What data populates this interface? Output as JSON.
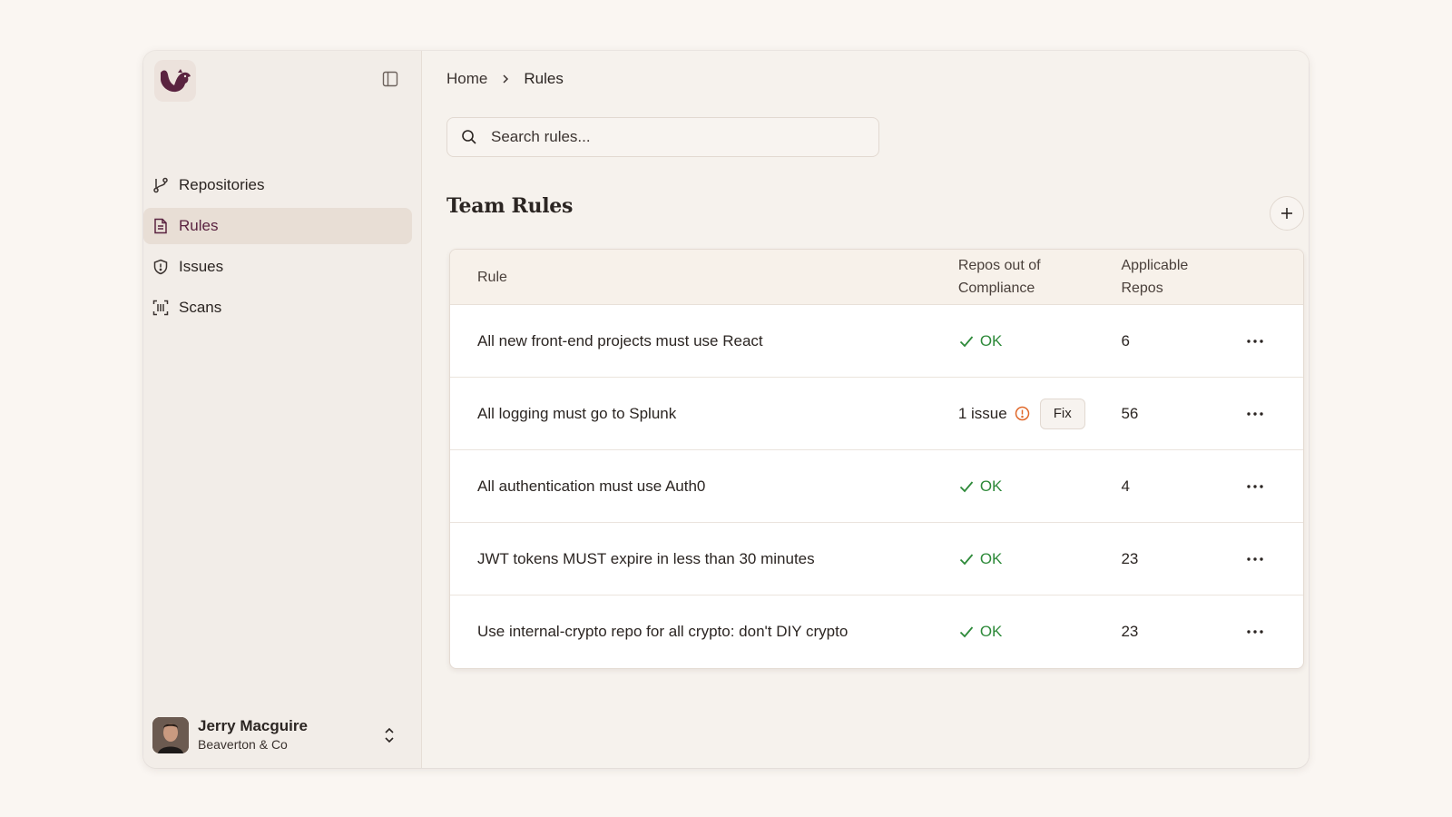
{
  "sidebar": {
    "logo_icon": "beaver-logo-icon",
    "toggle_icon": "sidebar-panel-icon",
    "items": [
      {
        "label": "Repositories",
        "icon": "git-branch-icon",
        "active": false
      },
      {
        "label": "Rules",
        "icon": "document-icon",
        "active": true
      },
      {
        "label": "Issues",
        "icon": "shield-alert-icon",
        "active": false
      },
      {
        "label": "Scans",
        "icon": "scan-barcode-icon",
        "active": false
      }
    ],
    "user": {
      "name": "Jerry Macguire",
      "org": "Beaverton & Co"
    }
  },
  "breadcrumb": {
    "home": "Home",
    "current": "Rules"
  },
  "search": {
    "placeholder": "Search rules..."
  },
  "section": {
    "title": "Team Rules"
  },
  "table": {
    "headers": {
      "rule": "Rule",
      "compliance_line1": "Repos out of",
      "compliance_line2": "Compliance",
      "applicable_line1": "Applicable",
      "applicable_line2": "Repos"
    },
    "rows": [
      {
        "rule": "All new front-end projects must use React",
        "status": "OK",
        "applicable": "6"
      },
      {
        "rule": "All logging must go to Splunk",
        "status": "1 issue",
        "fix_label": "Fix",
        "applicable": "56"
      },
      {
        "rule": "All authentication must use Auth0",
        "status": "OK",
        "applicable": "4"
      },
      {
        "rule": "JWT tokens MUST expire in less than 30 minutes",
        "status": "OK",
        "applicable": "23"
      },
      {
        "rule": "Use internal-crypto repo for all crypto: don't DIY crypto",
        "status": "OK",
        "applicable": "23"
      }
    ]
  },
  "colors": {
    "accent": "#5a2340",
    "ok_green": "#2e8a3a",
    "warn_orange": "#e0682a",
    "background": "#faf6f2"
  }
}
